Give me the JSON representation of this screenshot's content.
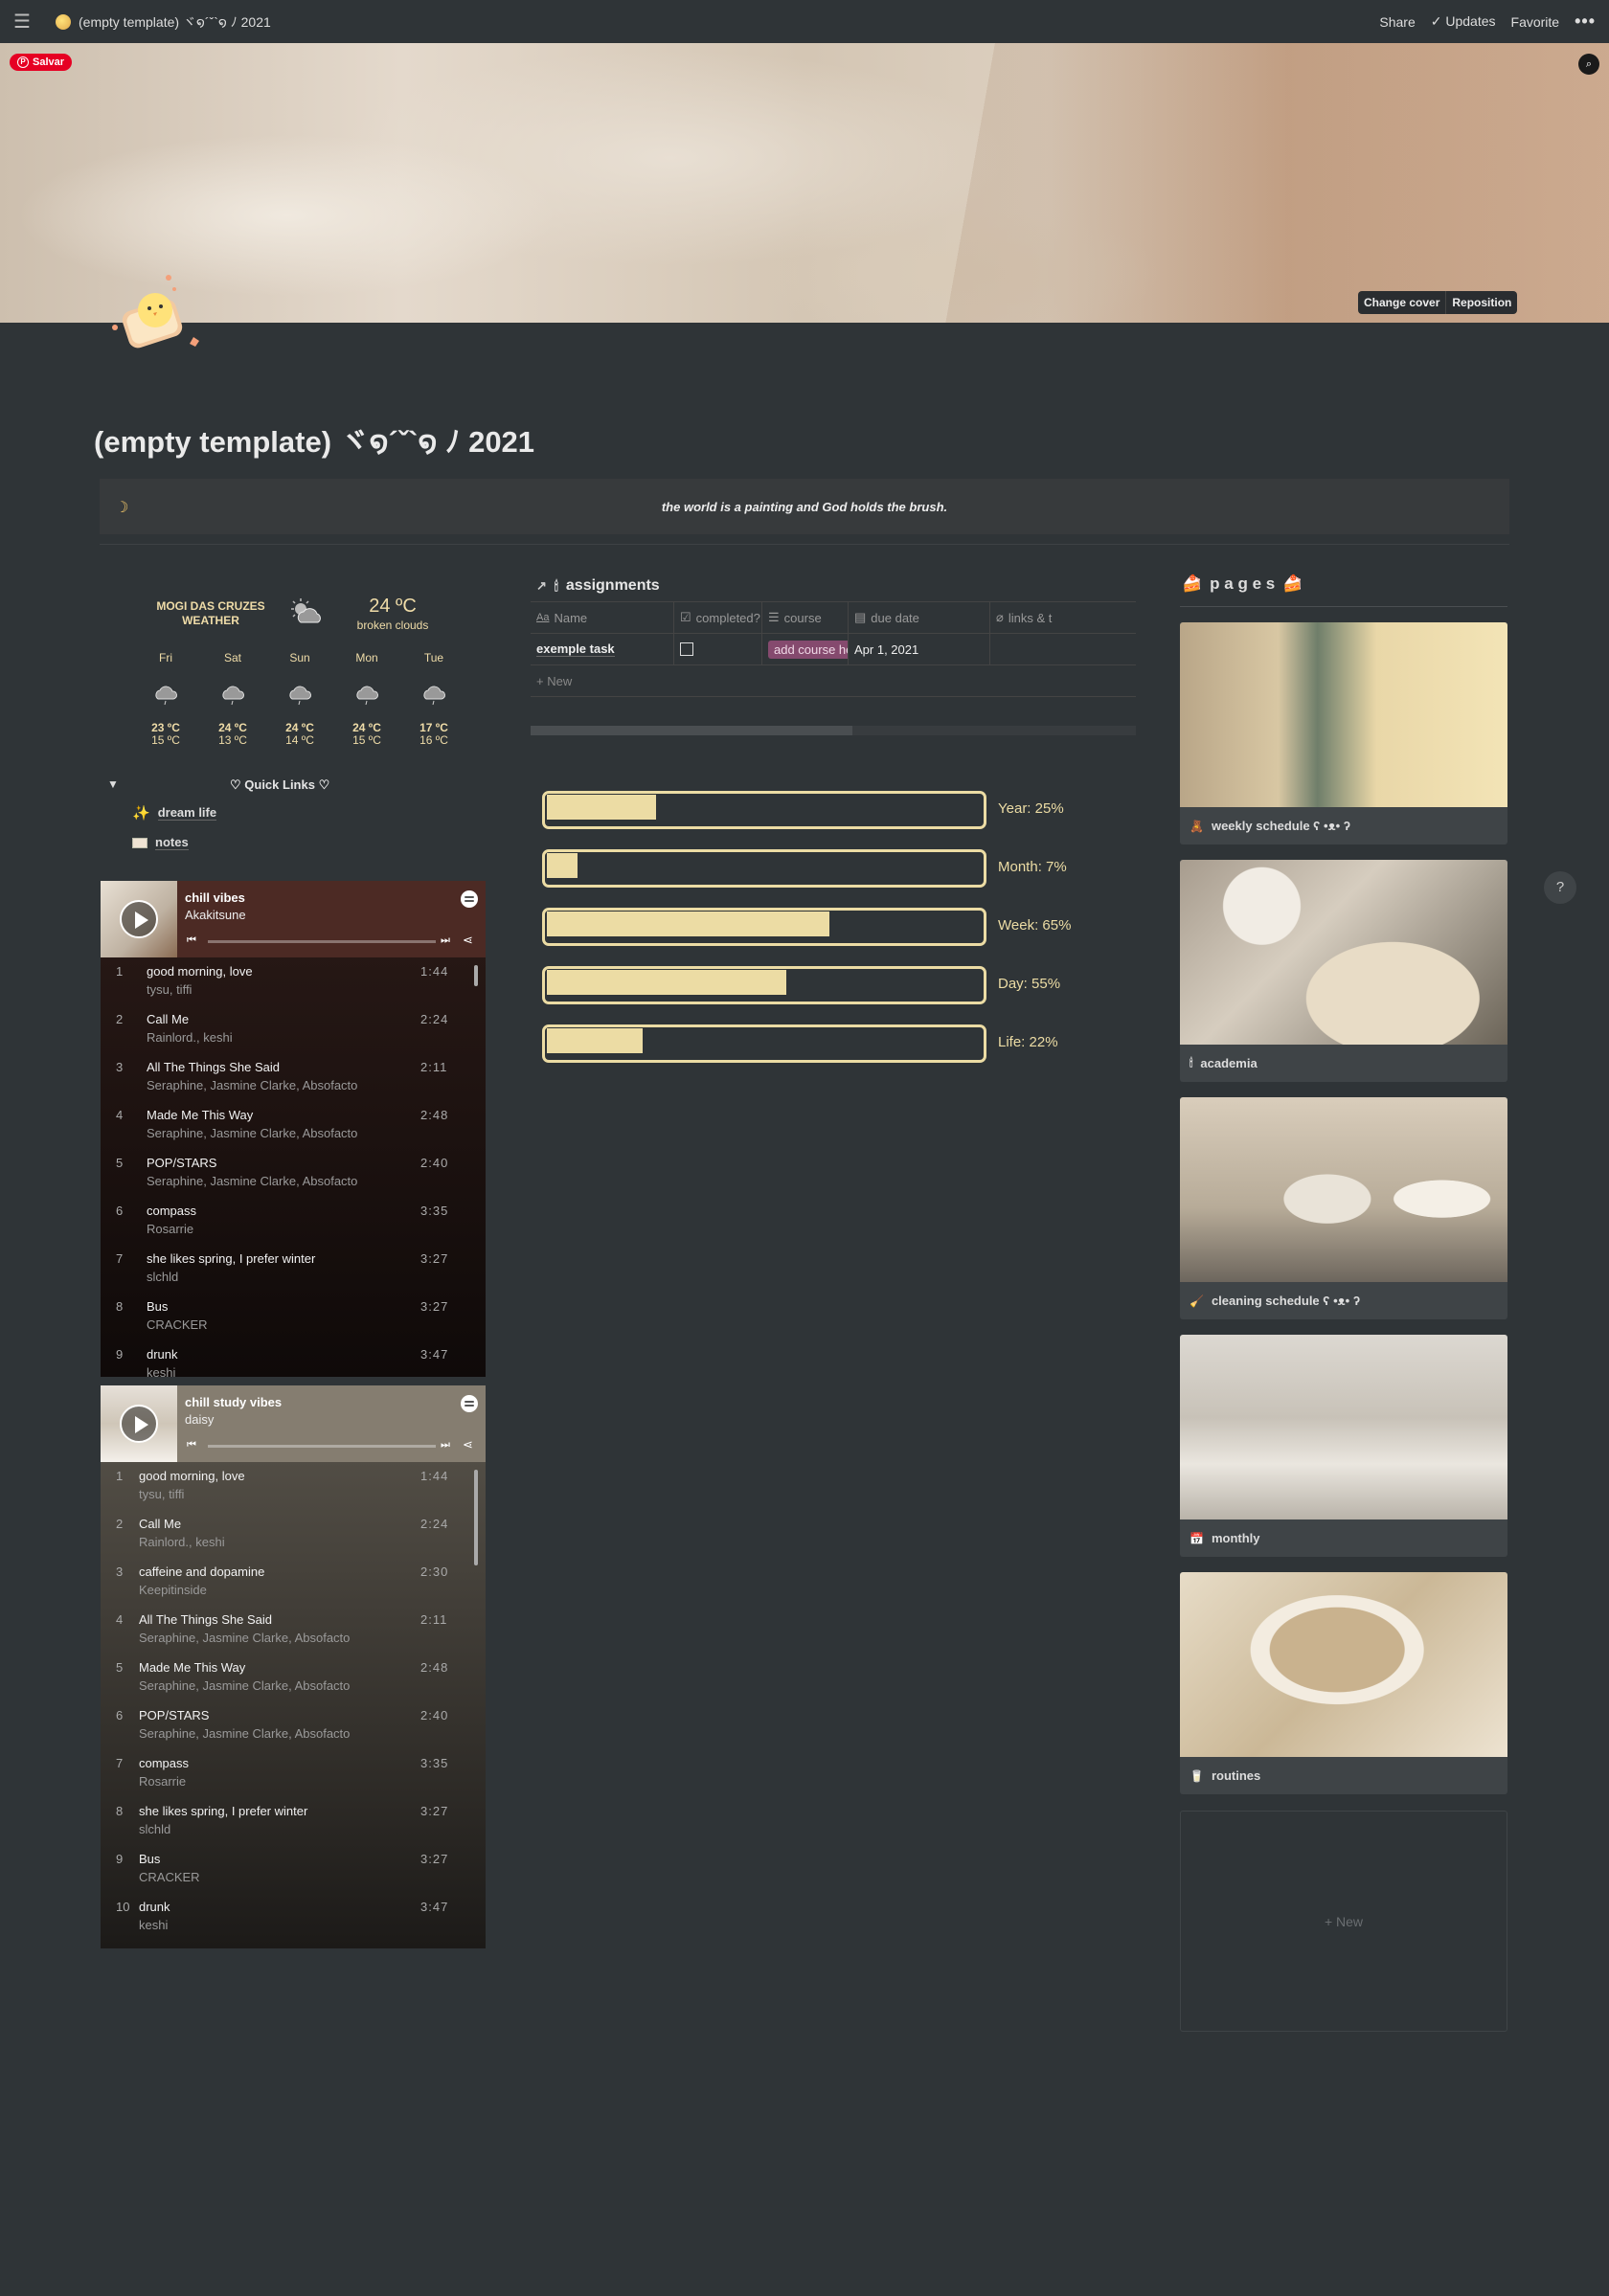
{
  "topbar": {
    "breadcrumb": "(empty template) ヾ໑´ˇ`໑ ﾉ 2021",
    "share": "Share",
    "updates": "✓ Updates",
    "favorite": "Favorite",
    "more": "•••"
  },
  "cover": {
    "pinterest_save": "Salvar",
    "change_cover": "Change cover",
    "reposition": "Reposition"
  },
  "page": {
    "title": "(empty template) ヾ໑´ˇ`໑ ﾉ 2021",
    "quote_icon": "☽",
    "quote": "the world is a painting and God holds the brush."
  },
  "weather": {
    "city": "MOGI DAS CRUZES WEATHER",
    "current_temp": "24 ºC",
    "current_desc": "broken clouds",
    "forecast": [
      {
        "day": "Fri",
        "high": "23 ºC",
        "low": "15 ºC"
      },
      {
        "day": "Sat",
        "high": "24 ºC",
        "low": "13 ºC"
      },
      {
        "day": "Sun",
        "high": "24 ºC",
        "low": "14 ºC"
      },
      {
        "day": "Mon",
        "high": "24 ºC",
        "low": "15 ºC"
      },
      {
        "day": "Tue",
        "high": "17 ºC",
        "low": "16 ºC"
      }
    ]
  },
  "quick_links": {
    "title": "♡ Quick Links ♡",
    "items": [
      {
        "label": "dream life",
        "icon": "sparkles-icon"
      },
      {
        "label": "notes",
        "icon": "envelope-icon"
      }
    ]
  },
  "playlists": [
    {
      "name": "chill vibes",
      "owner": "Akakitsune",
      "tracks": [
        {
          "n": "1",
          "title": "good morning, love",
          "artist": "tysu, tiffi",
          "duration": "1:44"
        },
        {
          "n": "2",
          "title": "Call Me",
          "artist": "Rainlord., keshi",
          "duration": "2:24"
        },
        {
          "n": "3",
          "title": "All The Things She Said",
          "artist": "Seraphine, Jasmine Clarke, Absofacto",
          "duration": "2:11"
        },
        {
          "n": "4",
          "title": "Made Me This Way",
          "artist": "Seraphine, Jasmine Clarke, Absofacto",
          "duration": "2:48"
        },
        {
          "n": "5",
          "title": "POP/STARS",
          "artist": "Seraphine, Jasmine Clarke, Absofacto",
          "duration": "2:40"
        },
        {
          "n": "6",
          "title": "compass",
          "artist": "Rosarrie",
          "duration": "3:35"
        },
        {
          "n": "7",
          "title": "she likes spring, I prefer winter",
          "artist": "slchld",
          "duration": "3:27"
        },
        {
          "n": "8",
          "title": "Bus",
          "artist": "CRACKER",
          "duration": "3:27"
        },
        {
          "n": "9",
          "title": "drunk",
          "artist": "keshi",
          "duration": "3:47"
        }
      ]
    },
    {
      "name": "chill study vibes",
      "owner": "daisy",
      "tracks": [
        {
          "n": "1",
          "title": "good morning, love",
          "artist": "tysu, tiffi",
          "duration": "1:44"
        },
        {
          "n": "2",
          "title": "Call Me",
          "artist": "Rainlord., keshi",
          "duration": "2:24"
        },
        {
          "n": "3",
          "title": "caffeine and dopamine",
          "artist": "Keepitinside",
          "duration": "2:30"
        },
        {
          "n": "4",
          "title": "All The Things She Said",
          "artist": "Seraphine, Jasmine Clarke, Absofacto",
          "duration": "2:11"
        },
        {
          "n": "5",
          "title": "Made Me This Way",
          "artist": "Seraphine, Jasmine Clarke, Absofacto",
          "duration": "2:48"
        },
        {
          "n": "6",
          "title": "POP/STARS",
          "artist": "Seraphine, Jasmine Clarke, Absofacto",
          "duration": "2:40"
        },
        {
          "n": "7",
          "title": "compass",
          "artist": "Rosarrie",
          "duration": "3:35"
        },
        {
          "n": "8",
          "title": "she likes spring, I prefer winter",
          "artist": "slchld",
          "duration": "3:27"
        },
        {
          "n": "9",
          "title": "Bus",
          "artist": "CRACKER",
          "duration": "3:27"
        },
        {
          "n": "10",
          "title": "drunk",
          "artist": "keshi",
          "duration": "3:47"
        }
      ]
    }
  ],
  "assignments": {
    "title": "assignments",
    "columns": [
      {
        "label": "Name",
        "icon": "Aa"
      },
      {
        "label": "completed?",
        "icon": "☑"
      },
      {
        "label": "course",
        "icon": "☰"
      },
      {
        "label": "due date",
        "icon": "▤"
      },
      {
        "label": "links & t",
        "icon": "⌀"
      }
    ],
    "rows": [
      {
        "name": "exemple task",
        "completed": false,
        "course": "add course here",
        "due_date": "Apr 1, 2021",
        "links": ""
      }
    ],
    "new_label": "+ New"
  },
  "progress": [
    {
      "label": "Year: 25%",
      "value": 25
    },
    {
      "label": "Month: 7%",
      "value": 7
    },
    {
      "label": "Week: 65%",
      "value": 65
    },
    {
      "label": "Day: 55%",
      "value": 55
    },
    {
      "label": "Life: 22%",
      "value": 22
    }
  ],
  "pages": {
    "title": "p a g e s",
    "items": [
      {
        "label": "weekly schedule ʕ •ᴥ• ʔ",
        "emoji": "🧸"
      },
      {
        "label": "academia",
        "emoji": "🕯"
      },
      {
        "label": "cleaning schedule ʕ •ᴥ• ʔ",
        "emoji": "🧹"
      },
      {
        "label": "monthly",
        "emoji": "📅"
      },
      {
        "label": "routines",
        "emoji": "🥛"
      }
    ],
    "new_label": "+ New"
  },
  "help": "?",
  "colors": {
    "background": "#2f3437",
    "accent_cream": "#ecdca4",
    "tag_pink": "#854a6e",
    "pinterest_red": "#e60023"
  }
}
